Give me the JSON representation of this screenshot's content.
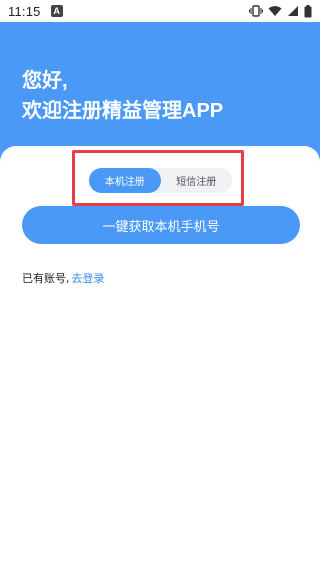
{
  "status_bar": {
    "time": "11:15",
    "indicator": "A",
    "icons": [
      "vibrate-icon",
      "wifi-icon",
      "signal-icon",
      "battery-icon"
    ]
  },
  "hero": {
    "line1": "您好,",
    "line2": "欢迎注册精益管理APP",
    "background_color": "#4a99f6"
  },
  "register_tabs": {
    "items": [
      {
        "label": "本机注册",
        "active": true
      },
      {
        "label": "短信注册",
        "active": false
      }
    ],
    "highlight_color": "#e53e4a"
  },
  "primary_button": {
    "label": "一键获取本机手机号"
  },
  "login": {
    "prompt": "已有账号,",
    "link": "去登录"
  }
}
